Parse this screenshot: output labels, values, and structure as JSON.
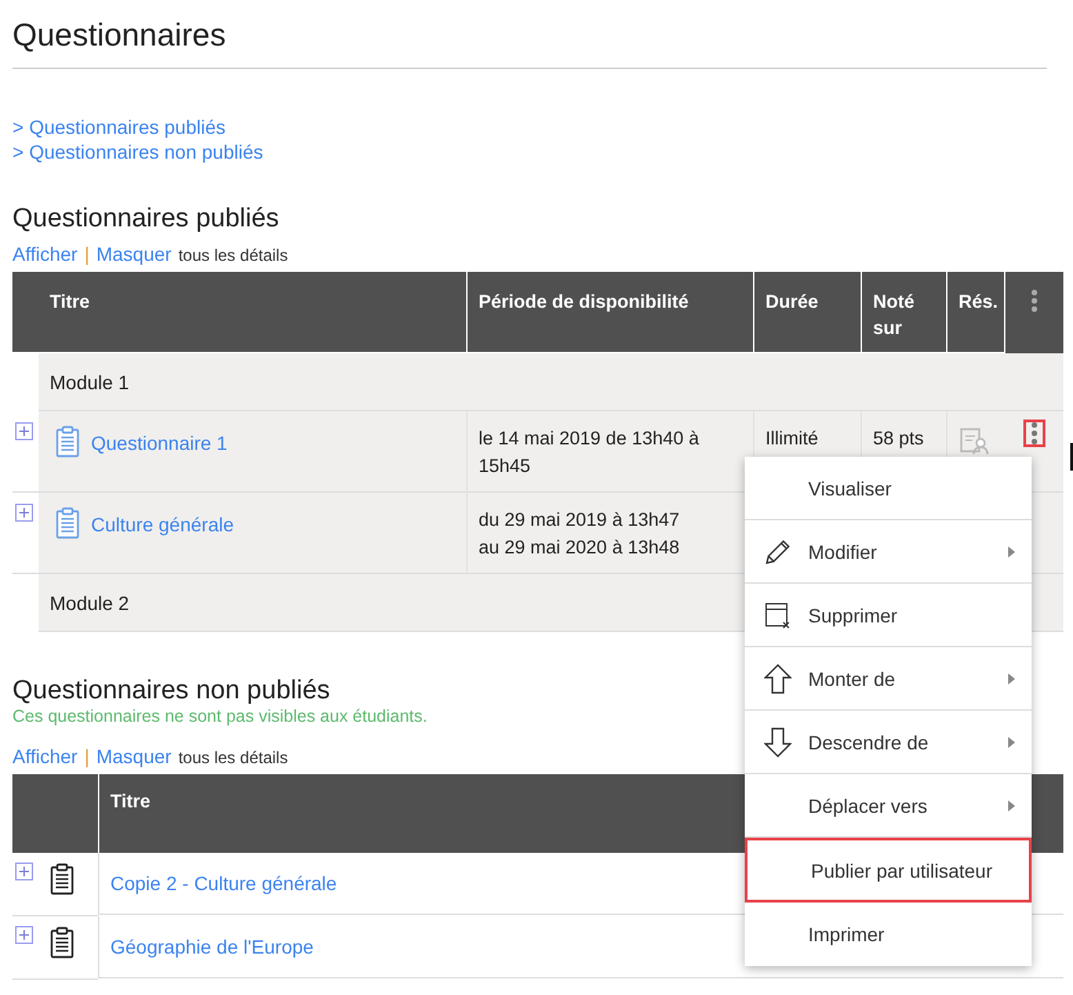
{
  "page_title": "Questionnaires",
  "anchor_links": [
    {
      "arrow": ">",
      "label": "Questionnaires publiés"
    },
    {
      "arrow": ">",
      "label": "Questionnaires non publiés"
    }
  ],
  "published": {
    "heading": "Questionnaires publiés",
    "details_toggle": {
      "show": "Afficher",
      "separator": "|",
      "hide": "Masquer",
      "suffix": "tous les détails"
    },
    "columns": [
      "Titre",
      "Période de disponibilité",
      "Durée",
      "Noté sur",
      "Rés."
    ],
    "rows": [
      {
        "kind": "group",
        "title": "Module 1"
      },
      {
        "kind": "item",
        "title": "Questionnaire 1",
        "period_lines": [
          "le 14 mai 2019 de 13h40 à",
          "15h45"
        ],
        "duration": "Illimité",
        "points": "58 pts",
        "menu_highlighted": true
      },
      {
        "kind": "item",
        "title": "Culture générale",
        "period_lines": [
          "du 29 mai 2019 à 13h47",
          "au 29 mai 2020 à 13h48"
        ],
        "menu_highlighted": false
      },
      {
        "kind": "group",
        "title": "Module 2"
      }
    ]
  },
  "unpublished": {
    "heading": "Questionnaires non publiés",
    "note": "Ces questionnaires ne sont pas visibles aux étudiants.",
    "details_toggle": {
      "show": "Afficher",
      "separator": "|",
      "hide": "Masquer",
      "suffix": "tous les détails"
    },
    "columns": [
      "Titre"
    ],
    "rows": [
      {
        "title": "Copie 2 - Culture générale"
      },
      {
        "title": "Géographie de l'Europe"
      }
    ]
  },
  "context_menu": {
    "items": [
      {
        "label": "Visualiser",
        "kind": "plain",
        "submenu": false,
        "highlighted": false
      },
      {
        "label": "Modifier",
        "kind": "edit",
        "submenu": true,
        "highlighted": false
      },
      {
        "label": "Supprimer",
        "kind": "remove",
        "submenu": false,
        "highlighted": false
      },
      {
        "label": "Monter de",
        "kind": "move-up",
        "submenu": true,
        "highlighted": false
      },
      {
        "label": "Descendre de",
        "kind": "move-down",
        "submenu": true,
        "highlighted": false
      },
      {
        "label": "Déplacer vers",
        "kind": "plain",
        "submenu": true,
        "highlighted": false
      },
      {
        "label": "Publier par utilisateur",
        "kind": "plain",
        "submenu": false,
        "highlighted": true
      },
      {
        "label": "Imprimer",
        "kind": "plain",
        "submenu": false,
        "highlighted": false
      }
    ]
  }
}
